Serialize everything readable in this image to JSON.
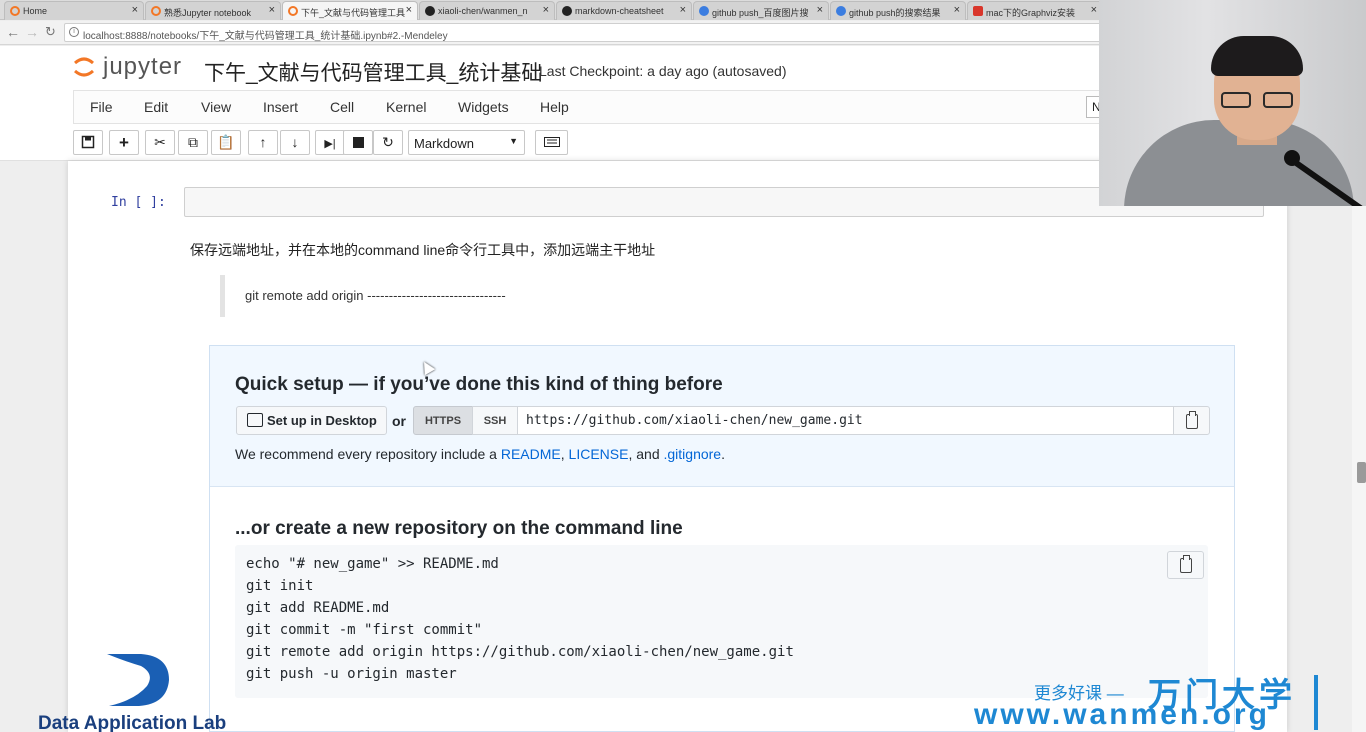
{
  "browser": {
    "tabs": [
      {
        "label": "Home",
        "close": "×"
      },
      {
        "label": "熟悉Jupyter notebook",
        "close": "×"
      },
      {
        "label": "下午_文献与代码管理工具",
        "close": "×"
      },
      {
        "label": "xiaoli-chen/wanmen_n",
        "close": "×"
      },
      {
        "label": "markdown-cheatsheet",
        "close": "×"
      },
      {
        "label": "github push_百度图片搜",
        "close": "×"
      },
      {
        "label": "github push的搜索结果",
        "close": "×"
      },
      {
        "label": "mac下的Graphviz安装",
        "close": "×"
      }
    ],
    "url": "localhost:8888/notebooks/下午_文献与代码管理工具_统计基础.ipynb#2.-Mendeley"
  },
  "jupyter": {
    "logo_text": "jupyter",
    "notebook_title": "下午_文献与代码管理工具_统计基础",
    "checkpoint": "Last Checkpoint: a day ago (autosaved)",
    "menu": [
      "File",
      "Edit",
      "View",
      "Insert",
      "Cell",
      "Kernel",
      "Widgets",
      "Help"
    ],
    "kernel_indicator": "N",
    "cell_type": "Markdown"
  },
  "notebook": {
    "prompt": "In  [ ]:",
    "paragraph": "保存远端地址，并在本地的command line命令行工具中，添加远端主干地址",
    "blockquote": "git remote add origin --------------------------------"
  },
  "github": {
    "quick_setup_title": "Quick setup — if you’ve done this kind of thing before",
    "desktop_button": "Set up in Desktop",
    "or": "or",
    "https": "HTTPS",
    "ssh": "SSH",
    "clone_url": "https://github.com/xiaoli-chen/new_game.git",
    "recommend_prefix": "We recommend every repository include a ",
    "readme": "README",
    "comma": ", ",
    "license": "LICENSE",
    "and": ", and ",
    "gitignore": ".gitignore",
    "period": ".",
    "new_repo_title": "...or create a new repository on the command line",
    "code_lines": [
      "echo \"# new_game\" >> README.md",
      "git init",
      "git add README.md",
      "git commit -m \"first commit\"",
      "git remote add origin https://github.com/xiaoli-chen/new_game.git",
      "git push -u origin master"
    ]
  },
  "watermark": {
    "lab_name": "Data Application Lab",
    "cn_slogan": "更多好课 —",
    "brand": "万门大学",
    "site": "www.wanmen.org"
  },
  "colors": {
    "jupyter_orange": "#f37726",
    "link_blue": "#0366d6",
    "watermark_blue": "#1e88d3",
    "dal_navy": "#1a3f7e"
  }
}
